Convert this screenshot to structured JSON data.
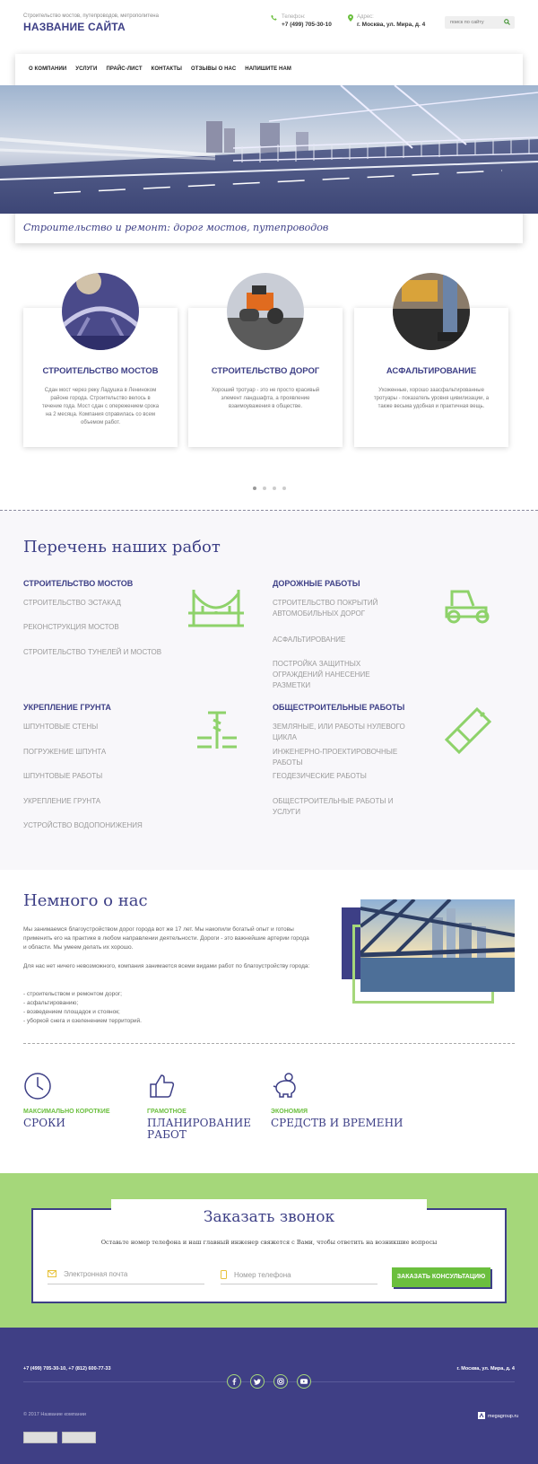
{
  "header": {
    "tagline": "Строительство мостов, путепроводов, метрополитена",
    "title": "НАЗВАНИЕ САЙТА",
    "phone_label": "Телефон:",
    "phone": "+7 (499) 705-30-10",
    "address_label": "Адрес:",
    "address": "г. Москва, ул. Мира, д. 4",
    "search_placeholder": "поиск по сайту"
  },
  "nav": [
    "О КОМПАНИИ",
    "УСЛУГИ",
    "ПРАЙС-ЛИСТ",
    "КОНТАКТЫ",
    "ОТЗЫВЫ О НАС",
    "НАПИШИТЕ НАМ"
  ],
  "hero_caption": "Строительство и ремонт: дорог мостов, путепроводов",
  "services": [
    {
      "title": "СТРОИТЕЛЬСТВО МОСТОВ",
      "text": "Сдан мост через реку Ладушка в Лениноком районе города. Строительство велось в течение года. Мост сдан с опережением срока на 2 месяца. Компания справилась со всем объемом работ."
    },
    {
      "title": "СТРОИТЕЛЬСТВО ДОРОГ",
      "text": "Хороший тротуар - это не просто красивый элемент ландшафта, а проявление взаимоуважения в обществе."
    },
    {
      "title": "АСФАЛЬТИРОВАНИЕ",
      "text": "Ухоженные, хорошо заасфальтированные тротуары - показатель уровня цивилизации, а также весьма удобная и практичная вещь."
    }
  ],
  "works": {
    "title": "Перечень наших работ",
    "groups": [
      {
        "heading": "СТРОИТЕЛЬСТВО МОСТОВ",
        "items": [
          "СТРОИТЕЛЬСТВО ЭСТАКАД",
          "РЕКОНСТРУКЦИЯ МОСТОВ",
          "СТРОИТЕЛЬСТВО ТУНЕЛЕЙ И МОСТОВ"
        ]
      },
      {
        "heading": "ДОРОЖНЫЕ РАБОТЫ",
        "items": [
          "СТРОИТЕЛЬСТВО ПОКРЫТИЙ АВТОМОБИЛЬНЫХ ДОРОГ",
          "АСФАЛЬТИРОВАНИЕ",
          "ПОСТРОЙКА ЗАЩИТНЫХ ОГРАЖДЕНИЙ НАНЕСЕНИЕ РАЗМЕТКИ"
        ]
      },
      {
        "heading": "УКРЕПЛЕНИЕ ГРУНТА",
        "items": [
          "ШПУНТОВЫЕ СТЕНЫ",
          "ПОГРУЖЕНИЕ ШПУНТА",
          "ШПУНТОВЫЕ РАБОТЫ",
          "УКРЕПЛЕНИЕ ГРУНТА",
          "УСТРОЙСТВО ВОДОПОНИЖЕНИЯ"
        ]
      },
      {
        "heading": "ОБЩЕСТРОИТЕЛЬНЫЕ РАБОТЫ",
        "items": [
          "ЗЕМЛЯНЫЕ, ИЛИ РАБОТЫ НУЛЕВОГО ЦИКЛА",
          "ИНЖЕНЕРНО-ПРОЕКТИРОВОЧНЫЕ РАБОТЫ",
          "ГЕОДЕЗИЧЕСКИЕ РАБОТЫ",
          "ОБЩЕСТРОИТЕЛЬНЫЕ РАБОТЫ И УСЛУГИ"
        ]
      }
    ]
  },
  "about": {
    "title": "Немного о нас",
    "p1": "Мы занимаемся благоустройством дорог города вот же 17 лет. Мы накопили богатый опыт и готовы применить его на практике в любом направлении деятельности. Дороги - это важнейшие артерии города и области. Мы умеем делать их хорошо.",
    "p2": "Для нас нет ничего невозможного, компания занимается всеми видами работ по благоустройству города:",
    "list": [
      "- строительством и ремонтом дорог;",
      "- асфальтированию;",
      "- возведением площадок и стоянок;",
      "- уборкой снега и озеленением территорий."
    ]
  },
  "features": [
    {
      "label": "МАКСИМАЛЬНО КОРОТКИЕ",
      "big": "СРОКИ"
    },
    {
      "label": "ГРАМОТНОЕ",
      "big": "ПЛАНИРОВАНИЕ РАБОТ"
    },
    {
      "label": "ЭКОНОМИЯ",
      "big": "СРЕДСТВ И ВРЕМЕНИ"
    }
  ],
  "callback": {
    "title": "Заказать звонок",
    "subtitle": "Оставьте номер телефона и наш главный инженер свяжется с Вами, чтобы ответить на возникшие вопросы",
    "email_placeholder": "Электронная почта",
    "phone_placeholder": "Номер телефона",
    "button": "ЗАКАЗАТЬ КОНСУЛЬТАЦИЮ"
  },
  "footer": {
    "phones": "+7 (499) 705-30-10, +7 (812) 600-77-33",
    "address": "г. Москва, ул. Мира, д. 4",
    "copyright": "© 2017 Название компании",
    "dev": "megagroup.ru"
  },
  "colors": {
    "primary": "#3d3f86",
    "accent": "#6bbf3e",
    "green_bg": "#a5d77a"
  }
}
